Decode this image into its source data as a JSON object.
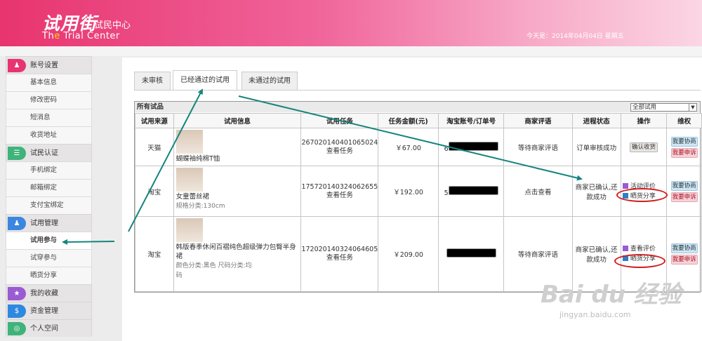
{
  "header": {
    "logo": "试用街",
    "logo_sub": "试民中心",
    "logo_en_prefix": "Th",
    "logo_en_t": "e",
    "logo_en_rest": " Trial Center",
    "today": "今天是：2014年04月04日  星期五"
  },
  "sidebar": {
    "sections": [
      {
        "label": "账号设置",
        "icon": "person-icon",
        "color": "#e8346f",
        "items": [
          "基本信息",
          "修改密码",
          "短消息",
          "收货地址"
        ]
      },
      {
        "label": "试民认证",
        "icon": "list-icon",
        "color": "#3fb37a",
        "items": [
          "手机绑定",
          "邮箱绑定",
          "支付宝绑定"
        ]
      },
      {
        "label": "试用管理",
        "icon": "person-icon",
        "color": "#3b86e0",
        "items": [
          "试用参与",
          "试穿参与",
          "晒货分享"
        ]
      },
      {
        "label": "我的收藏",
        "icon": "star-icon",
        "color": "#9a5bd3",
        "items": []
      },
      {
        "label": "资金管理",
        "icon": "money-bag-icon",
        "color": "#2f88e0",
        "items": []
      },
      {
        "label": "个人空间",
        "icon": "world-icon",
        "color": "#3fb37a",
        "items": []
      }
    ]
  },
  "tabs": [
    "未审核",
    "已经通过的试用",
    "未通过的试用"
  ],
  "table_bar": {
    "title": "所有试品",
    "select_value": "全部试用"
  },
  "columns": [
    "试用来源",
    "试用信息",
    "试用任务",
    "任务金额(元)",
    "淘宝账号/订单号",
    "商家评语",
    "进程状态",
    "操作",
    "维权"
  ],
  "rows": [
    {
      "source": "天猫",
      "product": "蝴蝶袖纯棉T恤",
      "attrs": [],
      "task_id": "267020140401065024",
      "task_link": "查看任务",
      "amount": "￥67.00",
      "account_hint": "6",
      "comment": "等待商家评语",
      "status": "订单审核成功",
      "op_button": "确认收货",
      "op_actions": [],
      "rights": [
        "我要协商",
        "我要申诉"
      ]
    },
    {
      "source": "淘宝",
      "product": "女童蕾丝裙",
      "attrs": [
        "规格分类:130cm"
      ],
      "task_id": "175720140324062655",
      "task_link": "查看任务",
      "amount": "￥192.00",
      "account_hint": "5",
      "comment": "点击查看",
      "status": "商家已确认,还款成功",
      "op_button": "",
      "op_actions": [
        "活动评价",
        "晒货分享"
      ],
      "rights": [
        "我要协商",
        "我要申诉"
      ]
    },
    {
      "source": "淘宝",
      "product": "韩版春季休闲百褶纯色超级弹力包臀半身裙",
      "attrs": [
        "颜色分类:黑色     尺码分类:均",
        "码"
      ],
      "task_id": "172020140324064605",
      "task_link": "查看任务",
      "amount": "￥209.00",
      "account_hint": "",
      "comment": "等待商家评语",
      "status": "商家已确认,还款成功",
      "op_button": "",
      "op_actions": [
        "查看评价",
        "晒货分享"
      ],
      "rights": [
        "我要协商",
        "我要申诉"
      ]
    }
  ],
  "watermark": {
    "brand": "Bai du 经验",
    "url": "jingyan.baidu.com"
  }
}
